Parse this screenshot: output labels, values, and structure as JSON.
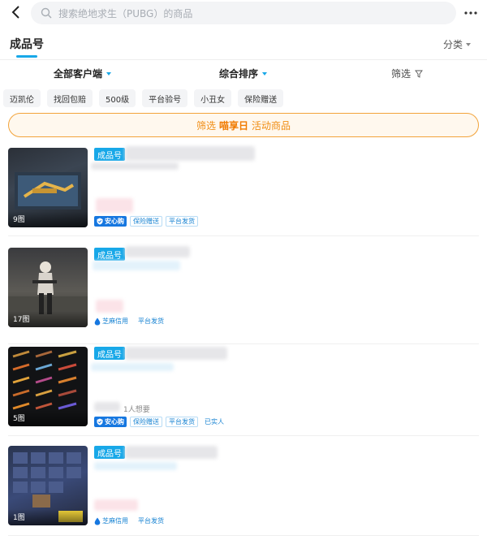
{
  "search": {
    "placeholder": "搜索绝地求生（PUBG）的商品"
  },
  "tabs": {
    "active": "成品号",
    "category": "分类"
  },
  "filters": {
    "client": "全部客户端",
    "sort": "综合排序",
    "filter": "筛选"
  },
  "tags": [
    "迈凯伦",
    "找回包赔",
    "500级",
    "平台验号",
    "小丑女",
    "保险赠送"
  ],
  "promo": {
    "prefix": "筛选",
    "highlight": "喵享日",
    "suffix": "活动商品"
  },
  "items": [
    {
      "badge": "成品号",
      "image_count": "9图",
      "anxin": "安心购",
      "tags": [
        "保险赠送",
        "平台发货"
      ]
    },
    {
      "badge": "成品号",
      "image_count": "17图",
      "sesame": "芝麻信用",
      "tags": [
        "平台发货"
      ]
    },
    {
      "badge": "成品号",
      "image_count": "5图",
      "want": "1人想要",
      "anxin": "安心购",
      "tags": [
        "保险赠送",
        "平台发货",
        "已实人"
      ]
    },
    {
      "badge": "成品号",
      "image_count": "1图",
      "sesame": "芝麻信用",
      "tags": [
        "平台发货"
      ]
    }
  ],
  "colors": {
    "accent": "#18a8e8",
    "promo": "#f08c12",
    "anxin": "#1677e0"
  }
}
